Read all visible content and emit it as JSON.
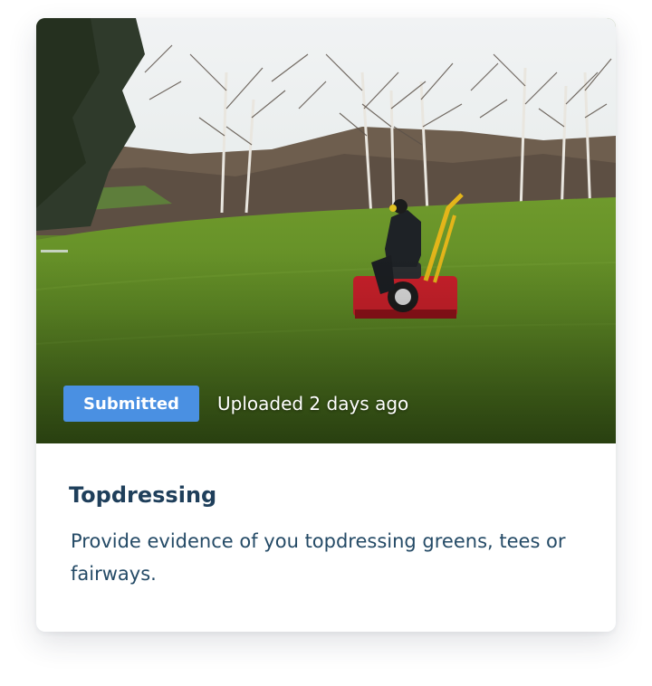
{
  "card": {
    "image": {
      "alt_subject": "golf-green-topdressing-photo"
    },
    "status_badge": "Submitted",
    "uploaded_text": "Uploaded 2 days ago",
    "title": "Topdressing",
    "description": "Provide evidence of you topdressing greens, tees or fairways."
  },
  "colors": {
    "badge_bg": "#4a90e2",
    "title_text": "#1f3f5b",
    "description_text": "#244a66"
  }
}
